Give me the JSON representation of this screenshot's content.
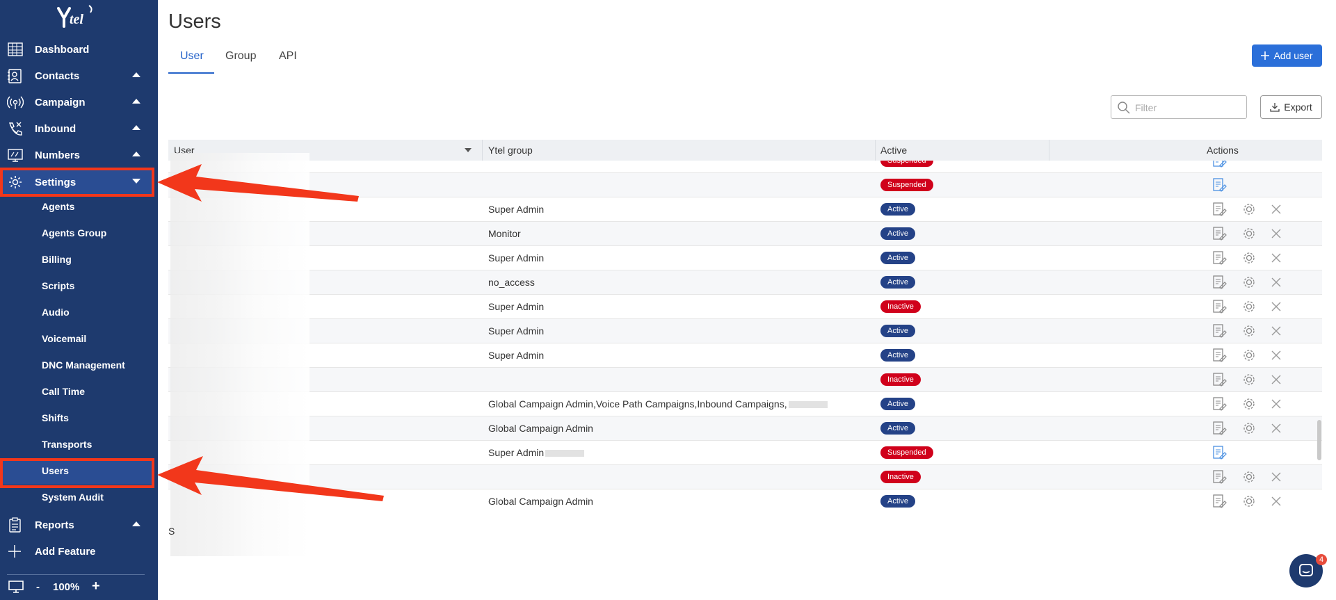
{
  "sidebar": {
    "logo_text": "Ytel",
    "items": [
      {
        "label": "Dashboard",
        "icon": "dashboard-grid-icon",
        "caret": ""
      },
      {
        "label": "Contacts",
        "icon": "contacts-card-icon",
        "caret": "up"
      },
      {
        "label": "Campaign",
        "icon": "broadcast-icon",
        "caret": "up"
      },
      {
        "label": "Inbound",
        "icon": "phone-incoming-icon",
        "caret": "up"
      },
      {
        "label": "Numbers",
        "icon": "numbers-screen-icon",
        "caret": "up"
      },
      {
        "label": "Settings",
        "icon": "gear-icon",
        "caret": "down"
      }
    ],
    "settings_submenu": [
      {
        "label": "Agents"
      },
      {
        "label": "Agents Group"
      },
      {
        "label": "Billing"
      },
      {
        "label": "Scripts"
      },
      {
        "label": "Audio"
      },
      {
        "label": "Voicemail"
      },
      {
        "label": "DNC Management"
      },
      {
        "label": "Call Time"
      },
      {
        "label": "Shifts"
      },
      {
        "label": "Transports"
      },
      {
        "label": "Users"
      },
      {
        "label": "System Audit"
      }
    ],
    "bottom_items": [
      {
        "label": "Reports",
        "icon": "clipboard-icon",
        "caret": "up"
      },
      {
        "label": "Add Feature",
        "icon": "plus-icon",
        "caret": ""
      }
    ],
    "zoom": {
      "minus": "-",
      "value": "100%",
      "plus": "+"
    }
  },
  "page": {
    "title": "Users",
    "tabs": [
      {
        "label": "User",
        "active": true
      },
      {
        "label": "Group",
        "active": false
      },
      {
        "label": "API",
        "active": false
      }
    ],
    "add_button": "Add user",
    "filter_placeholder": "Filter",
    "export_button": "Export"
  },
  "table": {
    "headers": {
      "user": "User",
      "group": "Ytel group",
      "active": "Active",
      "actions": "Actions"
    },
    "rows": [
      {
        "group": "",
        "status": "Suspended",
        "actions": "edit"
      },
      {
        "group": "",
        "status": "Suspended",
        "actions": "edit"
      },
      {
        "group": "Super Admin",
        "status": "Active",
        "actions": "all"
      },
      {
        "group": "Monitor",
        "status": "Active",
        "actions": "all"
      },
      {
        "group": "Super Admin",
        "status": "Active",
        "actions": "all"
      },
      {
        "group": "no_access",
        "status": "Active",
        "actions": "all"
      },
      {
        "group": "Super Admin",
        "status": "Inactive",
        "actions": "all"
      },
      {
        "group": "Super Admin",
        "status": "Active",
        "actions": "all"
      },
      {
        "group": "Super Admin",
        "status": "Active",
        "actions": "all"
      },
      {
        "group": "",
        "status": "Inactive",
        "actions": "all"
      },
      {
        "group": "Global Campaign Admin,Voice Path Campaigns,Inbound Campaigns,",
        "status": "Active",
        "actions": "all",
        "redacted_tail": true
      },
      {
        "group": "Global Campaign Admin",
        "status": "Active",
        "actions": "all"
      },
      {
        "group": "Super Admin",
        "status": "Suspended",
        "actions": "edit",
        "redacted_tail": true
      },
      {
        "group": "",
        "status": "Inactive",
        "actions": "all"
      },
      {
        "group": "Global Campaign Admin",
        "status": "Active",
        "actions": "all"
      }
    ]
  },
  "footer_text": "S",
  "chat": {
    "badge_count": "4"
  },
  "colors": {
    "sidebar_bg": "#1e3a6e",
    "active_item": "#2a4d93",
    "accent_blue": "#2b6fd9",
    "highlight_red": "#f2371b",
    "badge_active": "#244287",
    "badge_inactive": "#d0011b"
  }
}
